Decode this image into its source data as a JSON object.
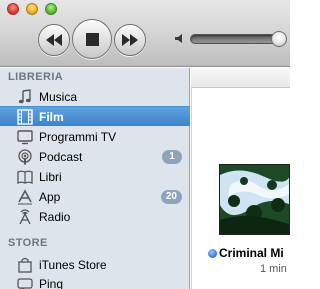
{
  "sidebar": {
    "library_title": "LIBRERIA",
    "store_title": "STORE",
    "library_items": [
      {
        "label": "Musica",
        "icon": "music-note-icon"
      },
      {
        "label": "Film",
        "icon": "film-icon",
        "selected": true
      },
      {
        "label": "Programmi TV",
        "icon": "tv-icon"
      },
      {
        "label": "Podcast",
        "icon": "podcast-icon",
        "badge": "1"
      },
      {
        "label": "Libri",
        "icon": "book-icon"
      },
      {
        "label": "App",
        "icon": "app-icon",
        "badge": "20"
      },
      {
        "label": "Radio",
        "icon": "radio-icon"
      }
    ],
    "store_items": [
      {
        "label": "iTunes Store",
        "icon": "itunes-store-icon"
      },
      {
        "label": "Ping",
        "icon": "ping-icon"
      }
    ]
  },
  "content": {
    "movie_title": "Criminal Mi",
    "movie_duration": "1 min"
  },
  "colors": {
    "selection": "#3d84cb",
    "sidebar_bg": "#dde4ec",
    "badge": "#8fa3bd",
    "status_dot": "#3c7fdc"
  }
}
